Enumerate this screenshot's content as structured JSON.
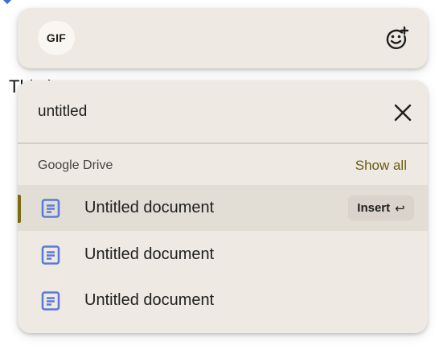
{
  "background": {
    "partial_text": "This is a ...ent"
  },
  "toolbar": {
    "gif_label": "GIF",
    "emoji_icon": "add-emoji-icon"
  },
  "search": {
    "value": "untitled",
    "close_icon": "close-icon"
  },
  "section": {
    "title": "Google Drive",
    "show_all_label": "Show all"
  },
  "results": [
    {
      "title": "Untitled document",
      "icon": "google-docs-icon",
      "selected": true
    },
    {
      "title": "Untitled document",
      "icon": "google-docs-icon",
      "selected": false
    },
    {
      "title": "Untitled document",
      "icon": "google-docs-icon",
      "selected": false
    }
  ],
  "insert": {
    "label": "Insert",
    "shortcut_glyph": "↩"
  },
  "colors": {
    "card_bg": "#eee9e2",
    "selected_row_bg": "#e2ddd5",
    "accent": "#6b5c10",
    "doc_icon": "#5b7bd6"
  }
}
